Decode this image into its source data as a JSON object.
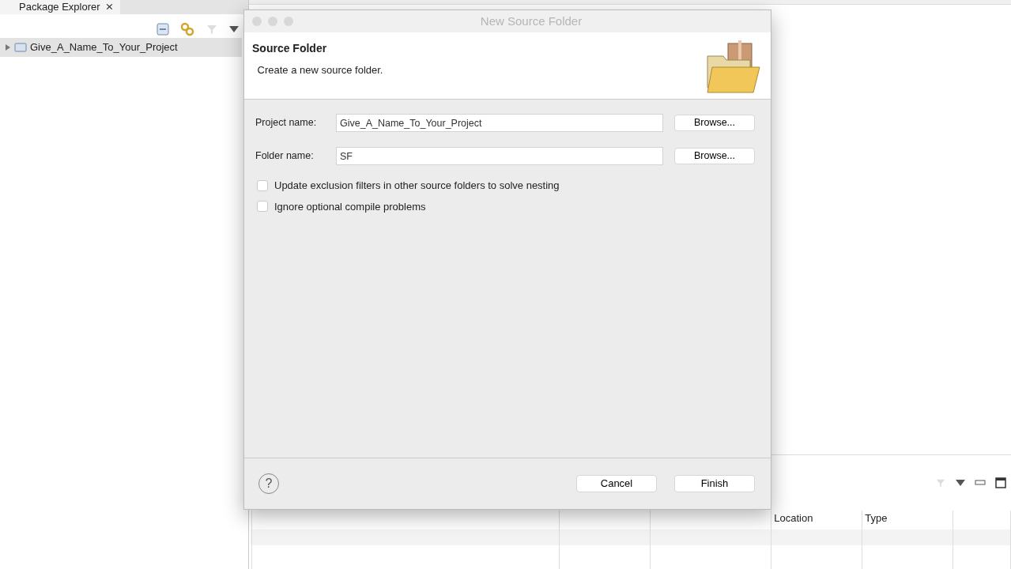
{
  "explorer": {
    "tab_label": "Package Explorer",
    "tab_close": "⨯",
    "tree": [
      {
        "label": "Give_A_Name_To_Your_Project",
        "expanded": false,
        "selected": true
      }
    ]
  },
  "problems": {
    "columns": [
      "Location",
      "Type"
    ]
  },
  "dialog": {
    "title": "New Source Folder",
    "heading": "Source Folder",
    "description": "Create a new source folder.",
    "fields": [
      {
        "label": "Project name:",
        "value": "Give_A_Name_To_Your_Project",
        "button": "Browse..."
      },
      {
        "label": "Folder name:",
        "value": "SF",
        "button": "Browse..."
      }
    ],
    "options": [
      {
        "label": "Update exclusion filters in other source folders to solve nesting",
        "checked": false
      },
      {
        "label": "Ignore optional compile problems",
        "checked": false
      }
    ],
    "help": "?",
    "buttons": [
      "Cancel",
      "Finish"
    ]
  }
}
